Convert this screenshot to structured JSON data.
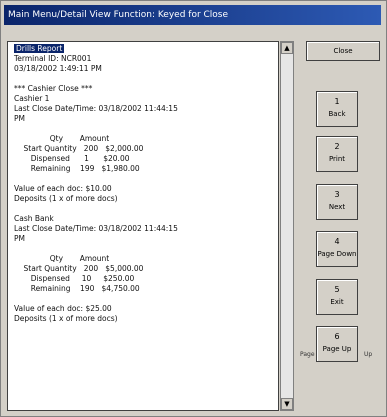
{
  "window": {
    "title": "Main Menu/Detail View Function: Keyed for Close"
  },
  "report": {
    "lines": [
      {
        "text": "Drills Report",
        "sel": true
      },
      {
        "text": "Terminal ID: NCR001"
      },
      {
        "text": "03/18/2002 1:49:11 PM"
      },
      {
        "text": ""
      },
      {
        "text": "*** Cashier Close ***"
      },
      {
        "text": "Cashier 1"
      },
      {
        "text": "Last Close Date/Time: 03/18/2002 11:44:15"
      },
      {
        "text": "PM"
      },
      {
        "text": ""
      },
      {
        "text": "               Qty       Amount"
      },
      {
        "text": "    Start Quantity   200   $2,000.00"
      },
      {
        "text": "       Dispensed      1      $20.00"
      },
      {
        "text": "       Remaining    199   $1,980.00"
      },
      {
        "text": ""
      },
      {
        "text": "Value of each doc: $10.00"
      },
      {
        "text": "Deposits (1 x of more docs)"
      },
      {
        "text": ""
      },
      {
        "text": "Cash Bank"
      },
      {
        "text": "Last Close Date/Time: 03/18/2002 11:44:15"
      },
      {
        "text": "PM"
      },
      {
        "text": ""
      },
      {
        "text": "               Qty       Amount"
      },
      {
        "text": "    Start Quantity   200   $5,000.00"
      },
      {
        "text": "       Dispensed     10     $250.00"
      },
      {
        "text": "       Remaining    190   $4,750.00"
      },
      {
        "text": ""
      },
      {
        "text": "Value of each doc: $25.00"
      },
      {
        "text": "Deposits (1 x of more docs)"
      }
    ]
  },
  "scrollbar": {
    "up": "▲",
    "down": "▼"
  },
  "buttons": {
    "close": "Close",
    "b1_num": "1",
    "b1_label": "Back",
    "b2_num": "2",
    "b2_label": "Print",
    "b3_num": "3",
    "b3_label": "Next",
    "b4_num": "4",
    "b4_label": "Page Down",
    "b5_num": "5",
    "b5_label": "Exit",
    "b6_num": "6",
    "b6_label": "Page Up"
  },
  "aside": {
    "left": "Page",
    "right": "Up"
  }
}
